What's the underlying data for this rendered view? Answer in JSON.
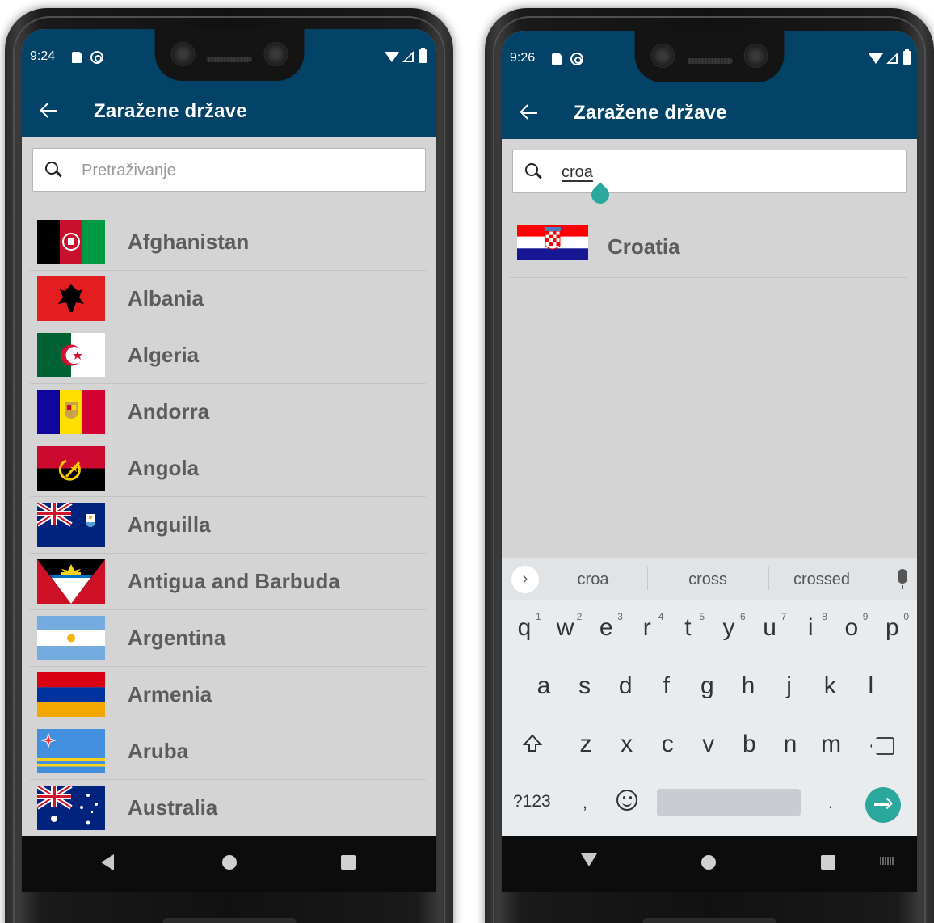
{
  "left_phone": {
    "status": {
      "time": "9:24"
    },
    "app_bar": {
      "title": "Zaražene države"
    },
    "search": {
      "placeholder": "Pretraživanje",
      "value": ""
    },
    "countries": [
      {
        "name": "Afghanistan",
        "flag_icon": "afghanistan-flag-icon"
      },
      {
        "name": "Albania",
        "flag_icon": "albania-flag-icon"
      },
      {
        "name": "Algeria",
        "flag_icon": "algeria-flag-icon"
      },
      {
        "name": "Andorra",
        "flag_icon": "andorra-flag-icon"
      },
      {
        "name": "Angola",
        "flag_icon": "angola-flag-icon"
      },
      {
        "name": "Anguilla",
        "flag_icon": "anguilla-flag-icon"
      },
      {
        "name": "Antigua and Barbuda",
        "flag_icon": "antigua-barbuda-flag-icon"
      },
      {
        "name": "Argentina",
        "flag_icon": "argentina-flag-icon"
      },
      {
        "name": "Armenia",
        "flag_icon": "armenia-flag-icon"
      },
      {
        "name": "Aruba",
        "flag_icon": "aruba-flag-icon"
      },
      {
        "name": "Australia",
        "flag_icon": "australia-flag-icon"
      }
    ]
  },
  "right_phone": {
    "status": {
      "time": "9:26"
    },
    "app_bar": {
      "title": "Zaražene države"
    },
    "search": {
      "value": "croa"
    },
    "results": [
      {
        "name": "Croatia",
        "flag_icon": "croatia-flag-icon"
      }
    ],
    "keyboard": {
      "suggestions": [
        "croa",
        "cross",
        "crossed"
      ],
      "row1": [
        "q",
        "w",
        "e",
        "r",
        "t",
        "y",
        "u",
        "i",
        "o",
        "p"
      ],
      "row1_numbers": [
        "1",
        "2",
        "3",
        "4",
        "5",
        "6",
        "7",
        "8",
        "9",
        "0"
      ],
      "row2": [
        "a",
        "s",
        "d",
        "f",
        "g",
        "h",
        "j",
        "k",
        "l"
      ],
      "row3": [
        "z",
        "x",
        "c",
        "v",
        "b",
        "n",
        "m"
      ],
      "symbols_key": "?123",
      "comma_key": ",",
      "period_key": "."
    }
  },
  "colors": {
    "app_bar": "#034368",
    "list_background": "#d4d4d4",
    "accent": "#2aa89d",
    "text": "#5c5c5c"
  }
}
